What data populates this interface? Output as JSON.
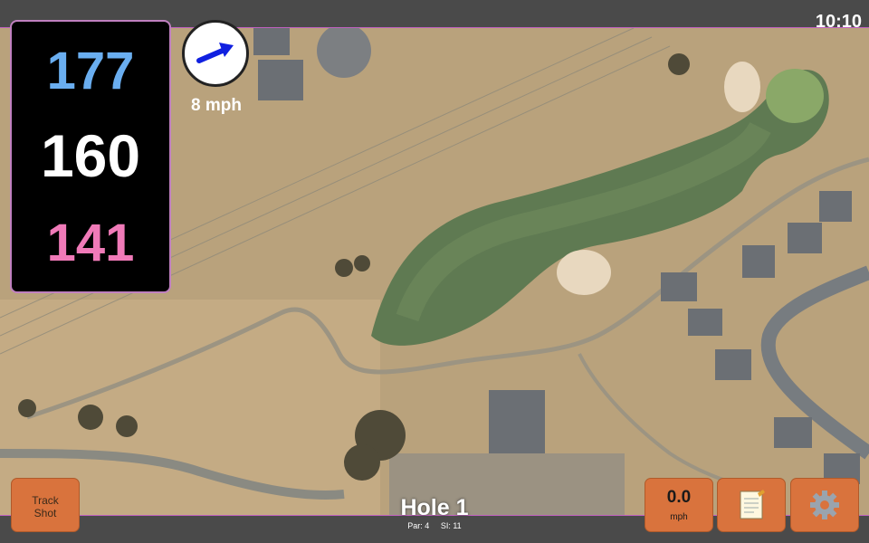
{
  "status": {
    "time": "10:10"
  },
  "distances": {
    "back": "177",
    "middle": "160",
    "front": "141",
    "colors": {
      "back": "#6aaef0",
      "middle": "#ffffff",
      "front": "#f07ab8"
    }
  },
  "wind": {
    "speed_label": "8 mph",
    "icon": "wind-direction-arrow"
  },
  "hole": {
    "title": "Hole 1",
    "par_label": "Par: 4",
    "si_label": "SI: 11"
  },
  "buttons": {
    "track_shot": {
      "line1": "Track",
      "line2": "Shot"
    },
    "speed": {
      "value": "0.0",
      "unit": "mph"
    },
    "notes": {
      "icon": "notepad-icon"
    },
    "settings": {
      "icon": "gear-icon"
    }
  },
  "theme": {
    "button_color": "#d9733d",
    "bar_color": "#4a4a4a",
    "accent_border": "#c060c0"
  }
}
